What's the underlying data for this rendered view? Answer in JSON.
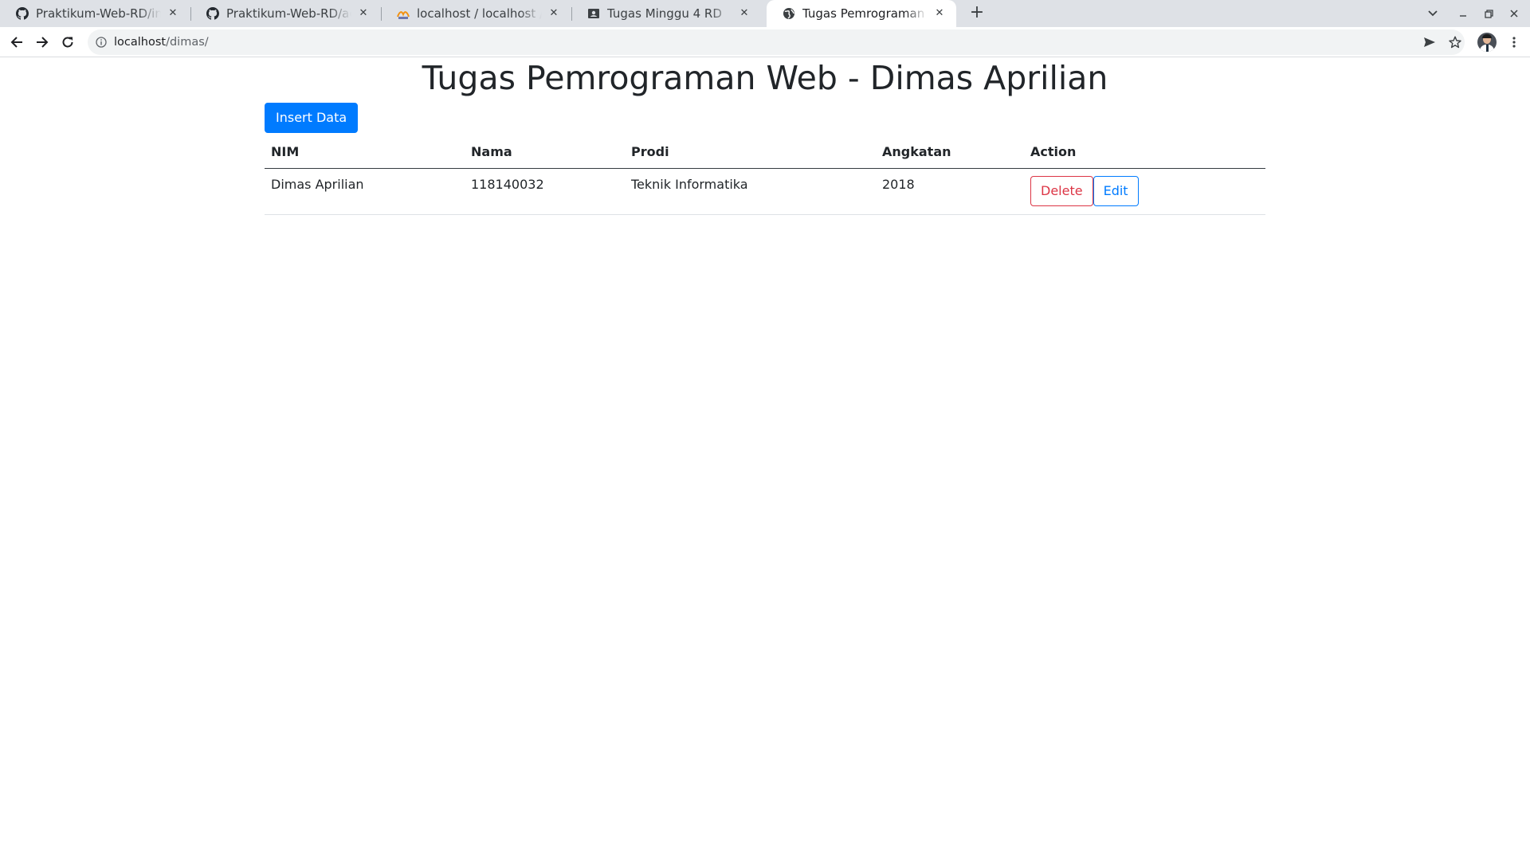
{
  "browser": {
    "tabs": [
      {
        "title": "Praktikum-Web-RD/index",
        "icon": "github-icon"
      },
      {
        "title": "Praktikum-Web-RD/action",
        "icon": "github-icon"
      },
      {
        "title": "localhost / localhost / pra",
        "icon": "phpmyadmin-icon"
      },
      {
        "title": "Tugas Minggu 4 RD",
        "icon": "classroom-icon"
      },
      {
        "title": "Tugas Pemrograman Web",
        "icon": "globe-icon"
      }
    ],
    "active_tab": 4,
    "close_glyph": "✕",
    "new_tab_glyph": "+",
    "url_host": "localhost",
    "url_path": "/dimas/"
  },
  "page": {
    "title": "Tugas Pemrograman Web - Dimas Aprilian",
    "insert_button": "Insert Data",
    "table": {
      "headers": [
        "NIM",
        "Nama",
        "Prodi",
        "Angkatan",
        "Action"
      ],
      "rows": [
        {
          "nim": "Dimas Aprilian",
          "nama": "118140032",
          "prodi": "Teknik Informatika",
          "angkatan": "2018"
        }
      ],
      "delete_label": "Delete",
      "edit_label": "Edit"
    }
  },
  "colors": {
    "primary": "#007bff",
    "danger": "#dc3545",
    "text": "#212529",
    "tabstrip": "#dee1e6"
  }
}
